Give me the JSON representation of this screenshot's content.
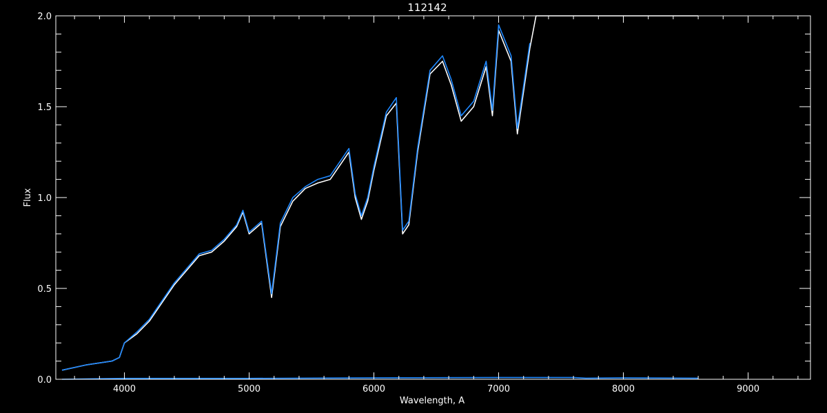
{
  "chart_data": {
    "type": "line",
    "title": "112142",
    "xlabel": "Wavelength, A",
    "ylabel": "Flux",
    "xlim": [
      3450,
      9500
    ],
    "ylim": [
      0.0,
      2.0
    ],
    "x_ticks": [
      4000,
      5000,
      6000,
      7000,
      8000,
      9000
    ],
    "x_tick_labels": [
      "4000",
      "5000",
      "6000",
      "7000",
      "8000",
      "9000"
    ],
    "y_ticks": [
      0.0,
      0.5,
      1.0,
      1.5,
      2.0
    ],
    "y_tick_labels": [
      "0.0",
      "0.5",
      "1.0",
      "1.5",
      "2.0"
    ],
    "grid": false,
    "background": "#000000",
    "axis_color": "#ffffff",
    "series": [
      {
        "color": "#ffffff",
        "x": [
          3500,
          3700,
          3900,
          3960,
          4000,
          4100,
          4200,
          4300,
          4400,
          4500,
          4600,
          4700,
          4800,
          4900,
          4950,
          5000,
          5100,
          5180,
          5250,
          5350,
          5450,
          5550,
          5650,
          5750,
          5800,
          5850,
          5900,
          5950,
          6000,
          6100,
          6180,
          6230,
          6280,
          6350,
          6450,
          6550,
          6620,
          6700,
          6800,
          6900,
          6950,
          7000,
          7100,
          7150,
          7250,
          7300,
          7500,
          7700,
          7900,
          8100,
          8300,
          8500,
          8600
        ],
        "y": [
          0.05,
          0.08,
          0.1,
          0.12,
          0.2,
          0.25,
          0.32,
          0.42,
          0.52,
          0.6,
          0.68,
          0.7,
          0.76,
          0.84,
          0.92,
          0.8,
          0.86,
          0.45,
          0.84,
          0.98,
          1.05,
          1.08,
          1.1,
          1.2,
          1.25,
          1.0,
          0.88,
          0.98,
          1.15,
          1.45,
          1.52,
          0.8,
          0.85,
          1.25,
          1.68,
          1.75,
          1.62,
          1.42,
          1.5,
          1.72,
          1.45,
          1.92,
          1.75,
          1.35,
          1.82,
          2.0,
          2.0,
          2.0,
          2.0,
          2.0,
          2.0,
          2.0,
          2.0
        ]
      },
      {
        "color": "#1e88ff",
        "x": [
          3500,
          3700,
          3900,
          3960,
          4000,
          4100,
          4200,
          4300,
          4400,
          4500,
          4600,
          4700,
          4800,
          4900,
          4950,
          5000,
          5100,
          5180,
          5250,
          5350,
          5450,
          5550,
          5650,
          5750,
          5800,
          5850,
          5900,
          5950,
          6000,
          6100,
          6180,
          6230,
          6280,
          6350,
          6450,
          6550,
          6620,
          6700,
          6800,
          6900,
          6950,
          7000,
          7100,
          7150,
          7250
        ],
        "y": [
          0.05,
          0.08,
          0.1,
          0.12,
          0.2,
          0.26,
          0.33,
          0.43,
          0.53,
          0.61,
          0.69,
          0.71,
          0.77,
          0.85,
          0.93,
          0.81,
          0.87,
          0.47,
          0.86,
          1.0,
          1.06,
          1.1,
          1.12,
          1.22,
          1.27,
          1.02,
          0.9,
          1.0,
          1.17,
          1.47,
          1.55,
          0.82,
          0.87,
          1.27,
          1.7,
          1.78,
          1.65,
          1.45,
          1.53,
          1.75,
          1.48,
          1.95,
          1.78,
          1.38,
          1.85
        ]
      },
      {
        "color": "#1e88ff",
        "x": [
          3500,
          4000,
          5000,
          6000,
          7000,
          7600,
          7700,
          8000,
          8600
        ],
        "y": [
          0.0,
          0.005,
          0.005,
          0.008,
          0.01,
          0.01,
          0.006,
          0.008,
          0.006
        ]
      }
    ]
  }
}
